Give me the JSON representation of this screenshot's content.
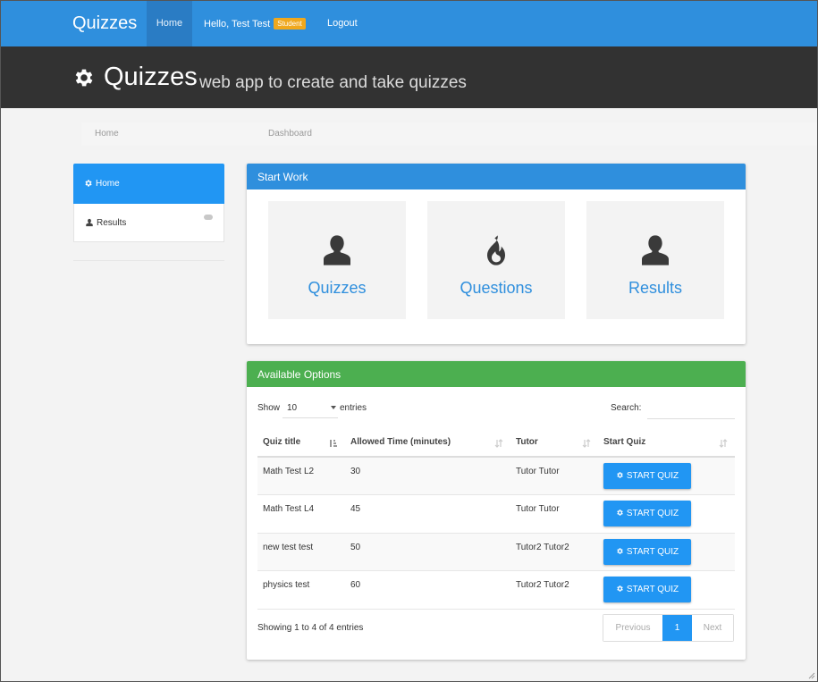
{
  "navbar": {
    "brand": "Quizzes",
    "home": "Home",
    "hello": "Hello, Test Test",
    "role_badge": "Student",
    "logout": "Logout"
  },
  "header": {
    "title": "Quizzes",
    "subtitle": "web app to create and take quizzes",
    "icon": "gear-icon"
  },
  "breadcrumb": [
    "Home",
    "Dashboard"
  ],
  "sidebar": {
    "items": [
      {
        "label": "Home",
        "icon": "gear-icon",
        "active": true
      },
      {
        "label": "Results",
        "icon": "user-icon",
        "active": false
      }
    ]
  },
  "start_work": {
    "title": "Start Work",
    "tiles": [
      {
        "label": "Quizzes",
        "icon": "user-icon"
      },
      {
        "label": "Questions",
        "icon": "fire-icon"
      },
      {
        "label": "Results",
        "icon": "user-icon"
      }
    ]
  },
  "options": {
    "title": "Available Options",
    "show_label": "Show",
    "page_length": "10",
    "entries_label": "entries",
    "search_label": "Search:",
    "columns": [
      "Quiz title",
      "Allowed Time (minutes)",
      "Tutor",
      "Start Quiz"
    ],
    "rows": [
      {
        "title": "Math Test L2",
        "time": "30",
        "tutor": "Tutor Tutor",
        "action": "START QUIZ"
      },
      {
        "title": "Math Test L4",
        "time": "45",
        "tutor": "Tutor Tutor",
        "action": "START QUIZ"
      },
      {
        "title": "new test test",
        "time": "50",
        "tutor": "Tutor2 Tutor2",
        "action": "START QUIZ"
      },
      {
        "title": "physics test",
        "time": "60",
        "tutor": "Tutor2 Tutor2",
        "action": "START QUIZ"
      }
    ],
    "info": "Showing 1 to 4 of 4 entries",
    "pager": {
      "previous": "Previous",
      "current": "1",
      "next": "Next"
    }
  },
  "colors": {
    "primary": "#2f8fdd",
    "accent_blue": "#2196f3",
    "success": "#4caf50",
    "badge": "#f0a81d",
    "header_dark": "#323232"
  }
}
